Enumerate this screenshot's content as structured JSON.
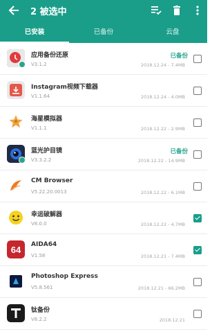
{
  "toolbar": {
    "title": "2 被选中",
    "back_icon": "arrow-left-icon",
    "select_icon": "select-all-icon",
    "delete_icon": "trash-icon",
    "more_icon": "more-vertical-icon"
  },
  "tabs": [
    {
      "label": "已安装",
      "active": true
    },
    {
      "label": "已备份",
      "active": false
    },
    {
      "label": "云盘",
      "active": false
    }
  ],
  "colors": {
    "accent": "#1a9e8a",
    "status": "#2aa58d"
  },
  "apps": [
    {
      "name": "应用备份还原",
      "version": "V3.1.2",
      "status": "已备份",
      "date": "2018.12.24",
      "size": "7.4MB",
      "checked": false,
      "icon": "app-backup-icon"
    },
    {
      "name": "Instagram视频下载器",
      "version": "V1.1.64",
      "status": "",
      "date": "2018.12.24",
      "size": "4.0MB",
      "checked": false,
      "icon": "instagram-downloader-icon"
    },
    {
      "name": "海星模拟器",
      "version": "V1.1.1",
      "status": "",
      "date": "2018.12.22",
      "size": "2.9MB",
      "checked": false,
      "icon": "starfish-emulator-icon"
    },
    {
      "name": "蓝光护目镜",
      "version": "V3.3.2.2",
      "status": "已备份",
      "date": "2018.12.22",
      "size": "14.9MB",
      "checked": false,
      "icon": "bluelight-filter-icon"
    },
    {
      "name": "CM Browser",
      "version": "V5.22.20.0013",
      "status": "",
      "date": "2018.12.22",
      "size": "6.1MB",
      "checked": false,
      "icon": "cm-browser-icon"
    },
    {
      "name": "幸运破解器",
      "version": "V8.0.0",
      "status": "",
      "date": "2018.12.22",
      "size": "4.7MB",
      "checked": true,
      "icon": "lucky-patcher-icon"
    },
    {
      "name": "AIDA64",
      "version": "V1.58",
      "status": "",
      "date": "2018.12.21",
      "size": "7.4MB",
      "checked": true,
      "icon": "aida64-icon"
    },
    {
      "name": "Photoshop Express",
      "version": "V5.8.561",
      "status": "",
      "date": "2018.12.21",
      "size": "66.2MB",
      "checked": false,
      "icon": "photoshop-express-icon"
    },
    {
      "name": "钛备份",
      "version": "V8.2.2",
      "status": "",
      "date": "2018.12.21",
      "size": "",
      "checked": false,
      "icon": "titanium-backup-icon"
    }
  ]
}
